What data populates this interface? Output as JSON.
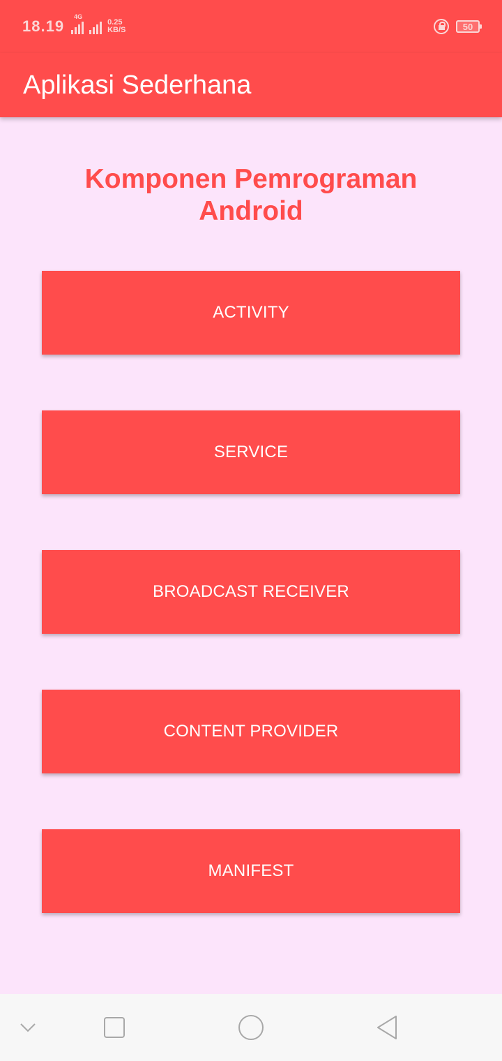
{
  "status_bar": {
    "time": "18.19",
    "network_type": "4G",
    "speed_value": "0.25",
    "speed_unit": "KB/S",
    "battery": "50",
    "icons": [
      "signal-icon",
      "signal-icon",
      "rotation-lock-icon",
      "battery-icon"
    ]
  },
  "app_bar": {
    "title": "Aplikasi Sederhana"
  },
  "main": {
    "heading_line1": "Komponen Pemrograman",
    "heading_line2": "Android",
    "buttons": [
      {
        "label": "ACTIVITY"
      },
      {
        "label": "SERVICE"
      },
      {
        "label": "BROADCAST RECEIVER"
      },
      {
        "label": "CONTENT PROVIDER"
      },
      {
        "label": "MANIFEST"
      }
    ]
  },
  "nav_bar": {
    "icons": [
      "chevron-down-icon",
      "recents-icon",
      "home-icon",
      "back-icon"
    ]
  },
  "colors": {
    "accent": "#FF4C4C",
    "background": "#FCE4FB",
    "nav_background": "#F7F7F7"
  }
}
